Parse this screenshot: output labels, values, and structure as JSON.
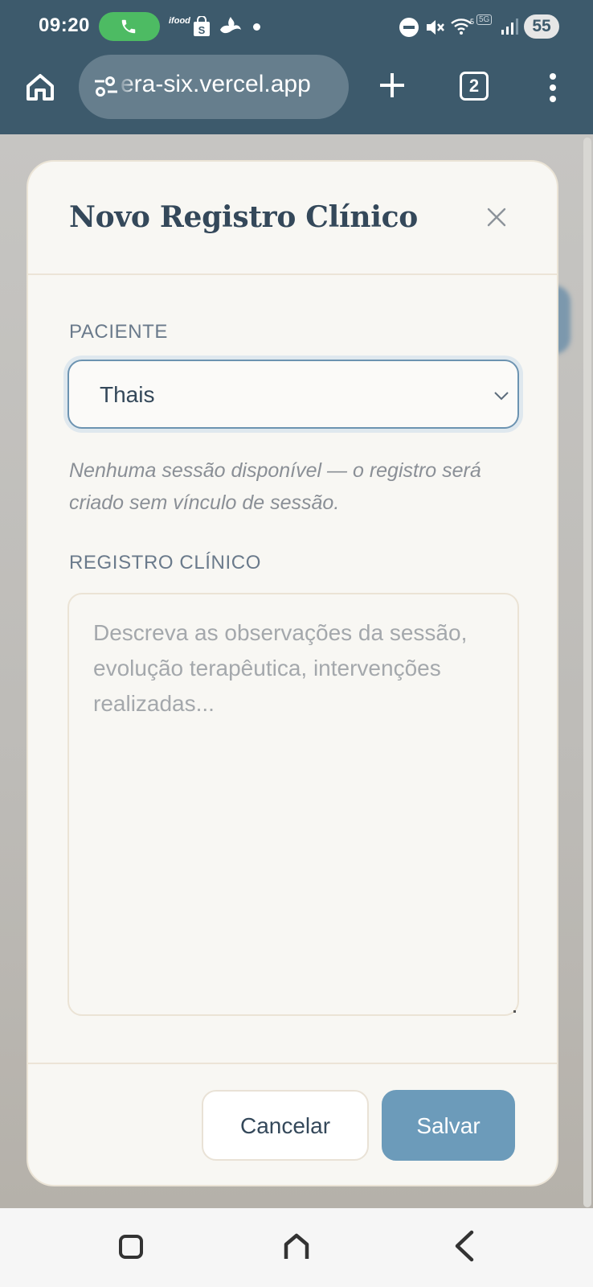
{
  "status_bar": {
    "time": "09:20",
    "app_label": "ifood",
    "network_badge": "5G",
    "battery_level": "55"
  },
  "browser": {
    "url": "era-six.vercel.app",
    "tab_count": "2"
  },
  "modal": {
    "title": "Novo Registro Clínico",
    "patient_label": "PACIENTE",
    "patient_value": "Thais",
    "hint": "Nenhuma sessão disponível — o registro será criado sem vínculo de sessão.",
    "record_label": "REGISTRO CLÍNICO",
    "record_placeholder": "Descreva as observações da sessão, evolução terapêutica, intervenções realizadas...",
    "cancel_label": "Cancelar",
    "save_label": "Salvar"
  },
  "colors": {
    "header": "#3d5a6c",
    "accent": "#6c9bba",
    "modal_bg": "#f8f7f3",
    "call_pill": "#4dbb63"
  },
  "icons": [
    "phone-icon",
    "shopping-bag-icon",
    "santander-icon",
    "dnd-icon",
    "mute-icon",
    "wifi-icon",
    "signal-icon",
    "home-icon",
    "site-settings-icon",
    "plus-icon",
    "more-vert-icon",
    "close-icon",
    "chevron-down-icon",
    "recents-icon",
    "nav-home-icon",
    "back-icon"
  ]
}
